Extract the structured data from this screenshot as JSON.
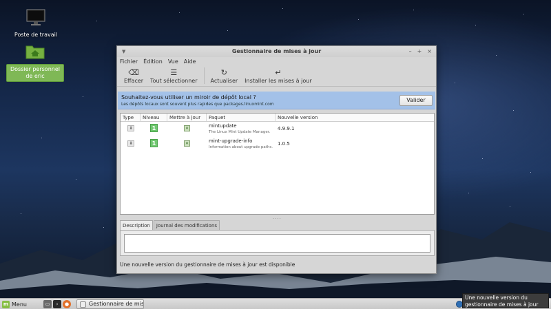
{
  "desktop": {
    "icons": [
      {
        "label": "Poste de travail",
        "icon": "monitor-icon"
      },
      {
        "label": "Dossier personnel de eric",
        "icon": "home-folder-icon"
      }
    ]
  },
  "window": {
    "title": "Gestionnaire de mises à jour",
    "controls": {
      "minimize": "–",
      "maximize": "+",
      "close": "×"
    },
    "menu": [
      "Fichier",
      "Édition",
      "Vue",
      "Aide"
    ],
    "toolbar": {
      "clear": "Effacer",
      "select_all": "Tout sélectionner",
      "refresh": "Actualiser",
      "install": "Installer les mises à jour"
    },
    "infobar": {
      "question": "Souhaitez-vous utiliser un miroir de dépôt local ?",
      "subtitle": "Les dépôts locaux sont souvent plus rapides que packages.linuxmint.com",
      "button": "Valider"
    },
    "table": {
      "headers": [
        "Type",
        "Niveau",
        "Mettre à jour",
        "Paquet",
        "Nouvelle version"
      ],
      "rows": [
        {
          "level": "1",
          "name": "mintupdate",
          "description": "The Linux Mint Update Manager.",
          "version": "4.9.9.1"
        },
        {
          "level": "1",
          "name": "mint-upgrade-info",
          "description": "Information about upgrade paths.",
          "version": "1.0.5"
        }
      ]
    },
    "tabs": [
      "Description",
      "Journal des modifications"
    ],
    "status": "Une nouvelle version du gestionnaire de mises à jour est disponible"
  },
  "panel": {
    "menu_label": "Menu",
    "task_label": "Gestionnaire de mise..."
  },
  "notification": {
    "text": "Une nouvelle version du gestionnaire de mises à jour est disponible"
  },
  "colors": {
    "accent_green": "#86be43",
    "infobar_blue": "#a3c1e8",
    "level_green": "#6fc76f"
  }
}
